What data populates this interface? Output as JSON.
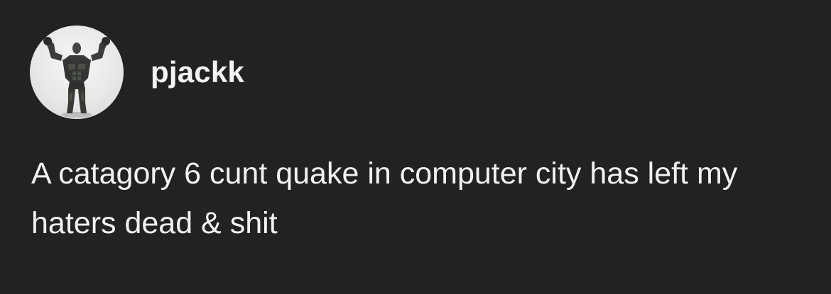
{
  "post": {
    "author": {
      "avatar_icon": "muscular-figure-avatar",
      "username": "pjackk"
    },
    "text": "A catagory 6 cunt quake in computer city has left my haters dead & shit"
  },
  "colors": {
    "background": "#222222",
    "text": "#f2f2f2"
  }
}
